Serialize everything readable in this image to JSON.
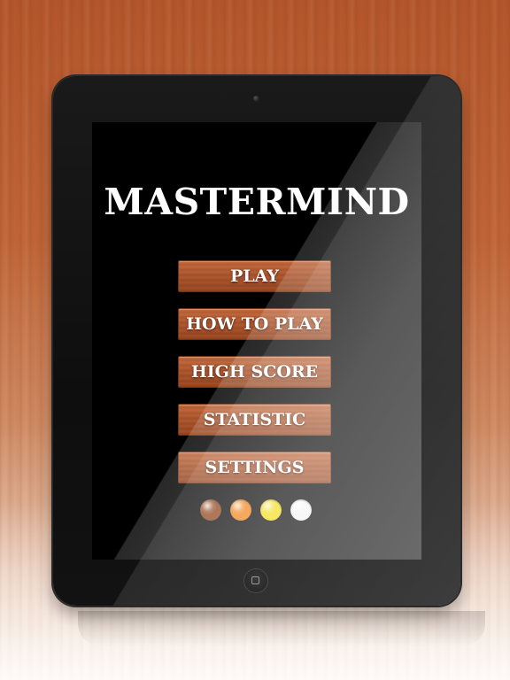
{
  "app": {
    "title": "MASTERMIND"
  },
  "menu": {
    "items": [
      {
        "label": "PLAY"
      },
      {
        "label": "HOW TO PLAY"
      },
      {
        "label": "HIGH SCORE"
      },
      {
        "label": "STATISTIC"
      },
      {
        "label": "SETTINGS"
      }
    ]
  },
  "pegs": [
    {
      "color_name": "brown",
      "color": "#8a3d12"
    },
    {
      "color_name": "orange",
      "color": "#f07f10"
    },
    {
      "color_name": "yellow",
      "color": "#f2dc10"
    },
    {
      "color_name": "white",
      "color": "#f4f4f4"
    }
  ],
  "icons": {
    "camera": "camera-icon",
    "home": "home-button-icon"
  }
}
